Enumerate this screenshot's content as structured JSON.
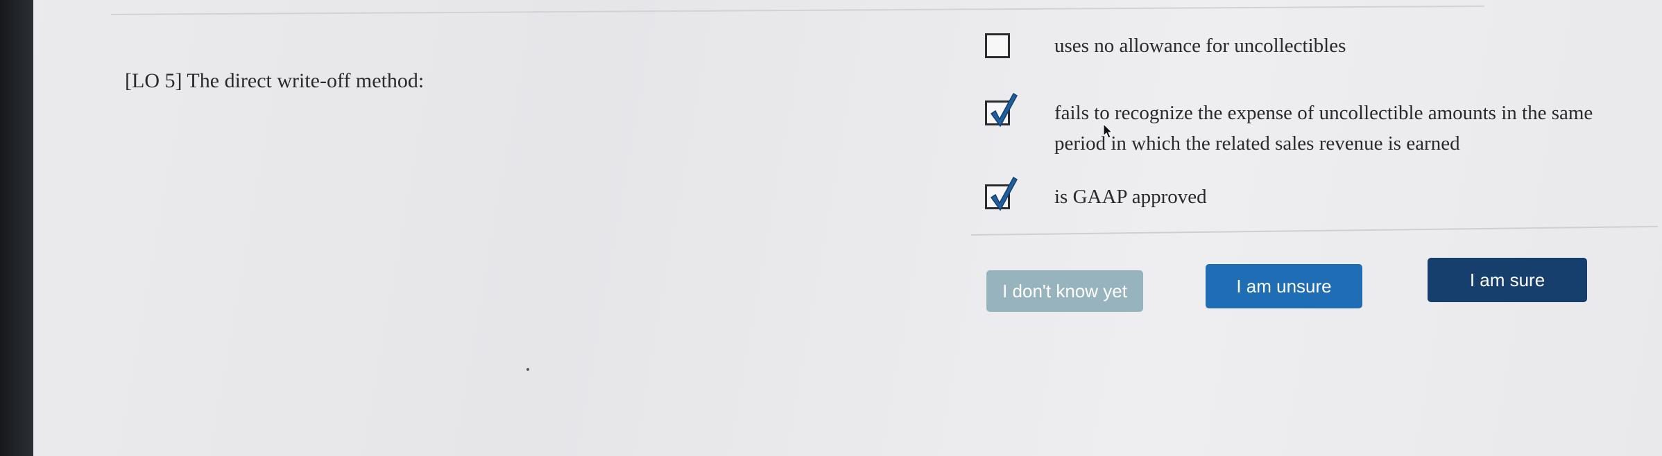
{
  "question": {
    "text": "[LO 5] The direct write-off method:"
  },
  "options": [
    {
      "text": "uses no allowance for uncollectibles",
      "checked": false
    },
    {
      "text": "fails to recognize the expense of uncollectible amounts in the same period in which the related sales revenue is earned",
      "checked": true
    },
    {
      "text": "is GAAP approved",
      "checked": true
    }
  ],
  "buttons": {
    "dont_know": "I don't know yet",
    "unsure": "I am unsure",
    "sure": "I am sure"
  },
  "colors": {
    "dont_know_button": "#97b3bd",
    "unsure_button": "#1f6eb5",
    "sure_button": "#163f6d",
    "check_mark": "#1f5f9e"
  },
  "icons": {
    "checkbox_checked": "checkmark-icon",
    "cursor": "mouse-pointer-icon"
  }
}
